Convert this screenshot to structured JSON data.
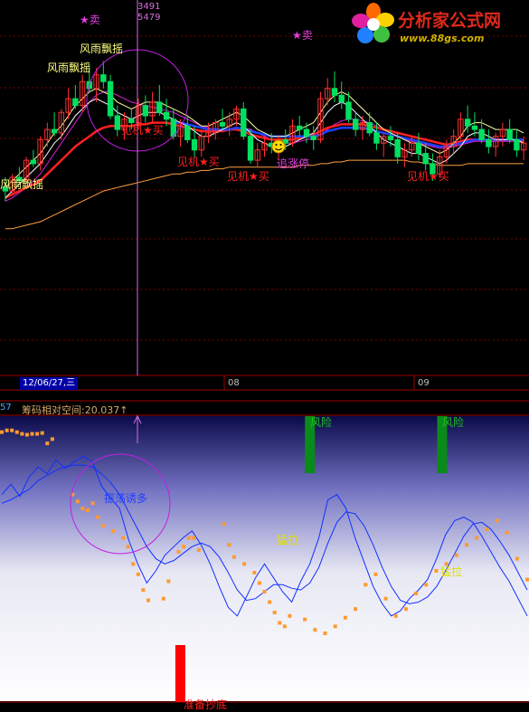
{
  "logo": {
    "title": "分析家公式网",
    "url": "www.88gs.com"
  },
  "cursor": {
    "value_top": "3491",
    "value_bottom": "5479"
  },
  "xaxis": {
    "date_tag": "12/06/27,三",
    "month_labels": [
      "08",
      "09"
    ]
  },
  "indicator": {
    "left_value": "57",
    "title": "筹码相对空间:20.037↑"
  },
  "colors": {
    "bg": "#000000",
    "up": "#ff3030",
    "down": "#00e060",
    "ma_blue": "#2040ff",
    "ma_red": "#ff2020",
    "ma_yellow": "#ffffa0",
    "ma_white": "#ffffff",
    "ma_orange": "#ffa040",
    "ma_magenta": "#e020e0",
    "cursor": "#d56ee0",
    "dots": "#ff9a30",
    "osc": "#1030ff"
  },
  "chart_data": [
    {
      "type": "candlestick",
      "candles": [
        [
          0,
          0,
          6,
          -8,
          -2
        ],
        [
          1,
          -2,
          8,
          -4,
          6
        ],
        [
          2,
          6,
          12,
          2,
          4
        ],
        [
          3,
          4,
          18,
          2,
          16
        ],
        [
          4,
          16,
          22,
          12,
          14
        ],
        [
          5,
          14,
          30,
          10,
          28
        ],
        [
          6,
          28,
          38,
          24,
          34
        ],
        [
          7,
          34,
          44,
          30,
          32
        ],
        [
          8,
          32,
          46,
          28,
          44
        ],
        [
          9,
          44,
          58,
          40,
          52
        ],
        [
          10,
          52,
          60,
          46,
          48
        ],
        [
          11,
          48,
          66,
          44,
          62
        ],
        [
          12,
          62,
          72,
          56,
          58
        ],
        [
          13,
          58,
          70,
          50,
          66
        ],
        [
          14,
          66,
          74,
          58,
          62
        ],
        [
          15,
          62,
          66,
          40,
          42
        ],
        [
          16,
          42,
          48,
          30,
          34
        ],
        [
          17,
          34,
          44,
          28,
          40
        ],
        [
          18,
          40,
          46,
          34,
          38
        ],
        [
          19,
          38,
          52,
          34,
          48
        ],
        [
          20,
          48,
          54,
          38,
          42
        ],
        [
          21,
          42,
          56,
          38,
          50
        ],
        [
          22,
          50,
          60,
          42,
          44
        ],
        [
          23,
          44,
          52,
          36,
          40
        ],
        [
          24,
          40,
          46,
          28,
          30
        ],
        [
          25,
          30,
          40,
          24,
          36
        ],
        [
          26,
          36,
          42,
          26,
          28
        ],
        [
          27,
          28,
          36,
          18,
          22
        ],
        [
          28,
          22,
          34,
          18,
          30
        ],
        [
          29,
          30,
          38,
          26,
          32
        ],
        [
          30,
          32,
          40,
          28,
          38
        ],
        [
          31,
          38,
          46,
          34,
          36
        ],
        [
          32,
          36,
          44,
          30,
          40
        ],
        [
          33,
          40,
          48,
          36,
          46
        ],
        [
          34,
          46,
          50,
          28,
          30
        ],
        [
          35,
          30,
          34,
          14,
          16
        ],
        [
          36,
          16,
          26,
          12,
          22
        ],
        [
          37,
          22,
          30,
          18,
          26
        ],
        [
          38,
          26,
          32,
          20,
          24
        ],
        [
          39,
          24,
          30,
          16,
          28
        ],
        [
          40,
          28,
          34,
          22,
          26
        ],
        [
          41,
          26,
          40,
          24,
          36
        ],
        [
          42,
          36,
          42,
          30,
          34
        ],
        [
          43,
          34,
          38,
          26,
          30
        ],
        [
          44,
          30,
          36,
          22,
          28
        ],
        [
          45,
          28,
          56,
          26,
          52
        ],
        [
          46,
          52,
          64,
          48,
          58
        ],
        [
          47,
          58,
          68,
          50,
          54
        ],
        [
          48,
          54,
          62,
          46,
          50
        ],
        [
          49,
          50,
          56,
          38,
          40
        ],
        [
          50,
          40,
          44,
          30,
          34
        ],
        [
          51,
          34,
          42,
          28,
          38
        ],
        [
          52,
          38,
          44,
          30,
          32
        ],
        [
          53,
          32,
          38,
          22,
          26
        ],
        [
          54,
          26,
          32,
          18,
          30
        ],
        [
          55,
          30,
          36,
          24,
          28
        ],
        [
          56,
          28,
          32,
          14,
          18
        ],
        [
          57,
          18,
          26,
          12,
          22
        ],
        [
          58,
          22,
          30,
          18,
          26
        ],
        [
          59,
          26,
          32,
          16,
          20
        ],
        [
          60,
          20,
          26,
          10,
          14
        ],
        [
          61,
          14,
          20,
          4,
          8
        ],
        [
          62,
          8,
          22,
          6,
          18
        ],
        [
          63,
          18,
          28,
          14,
          24
        ],
        [
          64,
          24,
          34,
          20,
          30
        ],
        [
          65,
          30,
          44,
          28,
          40
        ],
        [
          66,
          40,
          48,
          32,
          36
        ],
        [
          67,
          36,
          44,
          30,
          34
        ],
        [
          68,
          34,
          40,
          26,
          28
        ],
        [
          69,
          28,
          34,
          20,
          24
        ],
        [
          70,
          24,
          32,
          18,
          30
        ],
        [
          71,
          30,
          38,
          24,
          34
        ],
        [
          72,
          34,
          40,
          26,
          28
        ],
        [
          73,
          28,
          34,
          18,
          22
        ],
        [
          74,
          22,
          30,
          16,
          26
        ]
      ],
      "ma_blue": [
        null,
        null,
        null,
        null,
        null,
        null,
        null,
        null,
        null,
        null,
        null,
        null,
        null,
        null,
        null,
        null,
        null,
        null,
        null,
        null,
        null,
        null,
        null,
        null,
        38,
        38,
        37,
        36,
        35,
        34,
        34,
        34,
        34,
        35,
        34,
        33,
        32,
        31,
        30,
        30,
        30,
        30,
        30,
        30,
        30,
        31,
        33,
        34,
        35,
        35,
        35,
        35,
        34,
        33,
        32,
        31,
        30,
        29,
        28,
        27,
        26,
        25,
        24,
        24,
        25,
        26,
        27,
        28,
        28,
        28,
        28,
        28,
        28,
        28,
        28
      ],
      "ma_red": [
        -6,
        -4,
        -2,
        0,
        2,
        4,
        8,
        12,
        16,
        20,
        24,
        27,
        30,
        33,
        35,
        36,
        36,
        36,
        36,
        37,
        37,
        38,
        38,
        38,
        37,
        36,
        35,
        34,
        33,
        33,
        33,
        33,
        34,
        34,
        33,
        31,
        30,
        29,
        28,
        28,
        28,
        28,
        29,
        30,
        31,
        33,
        35,
        36,
        37,
        37,
        37,
        37,
        36,
        35,
        34,
        33,
        32,
        31,
        30,
        29,
        28,
        27,
        26,
        25,
        26,
        27,
        28,
        28,
        28,
        28,
        28,
        28,
        28,
        27,
        27
      ],
      "ma_white": [
        -6,
        -2,
        2,
        6,
        10,
        14,
        20,
        26,
        30,
        36,
        42,
        46,
        50,
        52,
        50,
        48,
        44,
        42,
        40,
        42,
        44,
        44,
        44,
        42,
        40,
        38,
        36,
        33,
        30,
        30,
        32,
        34,
        36,
        38,
        36,
        32,
        28,
        26,
        24,
        24,
        24,
        26,
        28,
        30,
        32,
        38,
        44,
        48,
        50,
        48,
        44,
        40,
        36,
        32,
        28,
        26,
        24,
        22,
        20,
        20,
        18,
        16,
        14,
        16,
        20,
        24,
        30,
        32,
        32,
        30,
        28,
        28,
        28,
        28,
        26
      ],
      "ma_orange": [
        -10,
        -10,
        -9,
        -8,
        -7,
        -6,
        -4,
        -2,
        0,
        2,
        4,
        6,
        8,
        10,
        12,
        13,
        14,
        15,
        16,
        17,
        18,
        19,
        20,
        21,
        22,
        22,
        23,
        23,
        24,
        24,
        25,
        25,
        26,
        26,
        26,
        26,
        26,
        26,
        26,
        26,
        26,
        26,
        27,
        27,
        27,
        28,
        28,
        29,
        29,
        30,
        30,
        30,
        30,
        30,
        30,
        30,
        30,
        30,
        29,
        29,
        28,
        28,
        27,
        27,
        27,
        27,
        28,
        28,
        28,
        28,
        28,
        28,
        28,
        28,
        28
      ],
      "ma_magenta": [
        -8,
        -6,
        -3,
        0,
        4,
        8,
        14,
        20,
        26,
        32,
        38,
        44,
        50,
        54,
        56,
        56,
        54,
        52,
        50,
        49,
        48,
        47,
        46,
        45,
        44,
        42,
        40,
        38,
        36,
        35,
        34,
        34,
        34,
        35,
        35,
        34,
        32,
        30,
        28,
        27,
        26,
        26,
        27,
        28,
        29,
        31,
        34,
        37,
        39,
        40,
        40,
        39,
        38,
        36,
        34,
        32,
        30,
        28,
        27,
        26,
        25,
        24,
        23,
        23,
        24,
        25,
        26,
        27,
        27,
        27,
        27,
        27,
        27,
        27,
        27
      ],
      "annotations": [
        "★卖",
        "风雨飘摇",
        "风雨飘摇",
        "风雨飘摇",
        "见机★买",
        "见机★买",
        "见机★买",
        "追涨停",
        "★卖",
        "见机★买"
      ]
    },
    {
      "type": "line",
      "series": [
        {
          "values": [
            40,
            52,
            38,
            60,
            72,
            64,
            80,
            70,
            78,
            84,
            78,
            50,
            36,
            24,
            -12,
            -40,
            -62,
            -48,
            -30,
            -20,
            -10,
            -2,
            -18,
            -40,
            -66,
            -90,
            -100,
            -78,
            -56,
            -40,
            -56,
            -72,
            -84,
            -60,
            -40,
            -10,
            34,
            40,
            24,
            -10,
            -38,
            -66,
            -86,
            -100,
            -94,
            -80,
            -70,
            -58,
            -34,
            -6,
            10,
            14,
            8,
            -8,
            -26,
            -44,
            -60,
            -80,
            -100
          ]
        },
        {
          "values": [
            30,
            34,
            40,
            46,
            56,
            62,
            68,
            72,
            74,
            74,
            72,
            64,
            54,
            40,
            20,
            0,
            -20,
            -34,
            -40,
            -36,
            -28,
            -20,
            -16,
            -20,
            -32,
            -50,
            -70,
            -82,
            -80,
            -72,
            -64,
            -64,
            -68,
            -70,
            -62,
            -44,
            -16,
            8,
            20,
            18,
            4,
            -18,
            -44,
            -66,
            -82,
            -86,
            -84,
            -78,
            -66,
            -48,
            -28,
            -8,
            6,
            8,
            0,
            -14,
            -30,
            -50,
            -70
          ]
        }
      ],
      "dots": [
        [
          0,
          112
        ],
        [
          1,
          114
        ],
        [
          2,
          114
        ],
        [
          3,
          112
        ],
        [
          4,
          110
        ],
        [
          5,
          109
        ],
        [
          6,
          110
        ],
        [
          7,
          110
        ],
        [
          8,
          111
        ],
        [
          9,
          99
        ],
        [
          10,
          104
        ],
        [
          14,
          40
        ],
        [
          15,
          32
        ],
        [
          16,
          24
        ],
        [
          17,
          22
        ],
        [
          18,
          30
        ],
        [
          19,
          14
        ],
        [
          20,
          4
        ],
        [
          22,
          -2
        ],
        [
          24,
          -10
        ],
        [
          25,
          -20
        ],
        [
          26,
          -40
        ],
        [
          27,
          -52
        ],
        [
          28,
          -70
        ],
        [
          29,
          -82
        ],
        [
          32,
          -80
        ],
        [
          33,
          -60
        ],
        [
          35,
          -26
        ],
        [
          36,
          -20
        ],
        [
          37,
          -10
        ],
        [
          38,
          -10
        ],
        [
          39,
          -24
        ],
        [
          44,
          6
        ],
        [
          45,
          -18
        ],
        [
          46,
          -32
        ],
        [
          48,
          -40
        ],
        [
          50,
          -50
        ],
        [
          51,
          -62
        ],
        [
          52,
          -72
        ],
        [
          53,
          -84
        ],
        [
          54,
          -96
        ],
        [
          55,
          -108
        ],
        [
          56,
          -112
        ],
        [
          57,
          -100
        ],
        [
          60,
          -104
        ],
        [
          62,
          -116
        ],
        [
          64,
          -120
        ],
        [
          66,
          -112
        ],
        [
          68,
          -102
        ],
        [
          70,
          -92
        ],
        [
          72,
          -64
        ],
        [
          74,
          -52
        ],
        [
          76,
          -80
        ],
        [
          78,
          -100
        ],
        [
          80,
          -92
        ],
        [
          82,
          -74
        ],
        [
          84,
          -64
        ],
        [
          86,
          -48
        ],
        [
          88,
          -40
        ],
        [
          90,
          -30
        ],
        [
          92,
          -18
        ],
        [
          94,
          -10
        ],
        [
          96,
          0
        ],
        [
          98,
          10
        ],
        [
          100,
          -4
        ],
        [
          102,
          -34
        ],
        [
          104,
          -58
        ]
      ],
      "bars": [
        {
          "x": 0.585,
          "kind": "green",
          "label": "风险"
        },
        {
          "x": 0.835,
          "kind": "green",
          "label": "风险"
        },
        {
          "x": 0.34,
          "kind": "red",
          "label": "准备抄底"
        }
      ],
      "annotations": [
        "振荡诱多",
        "猛拉",
        "猛拉"
      ]
    }
  ]
}
